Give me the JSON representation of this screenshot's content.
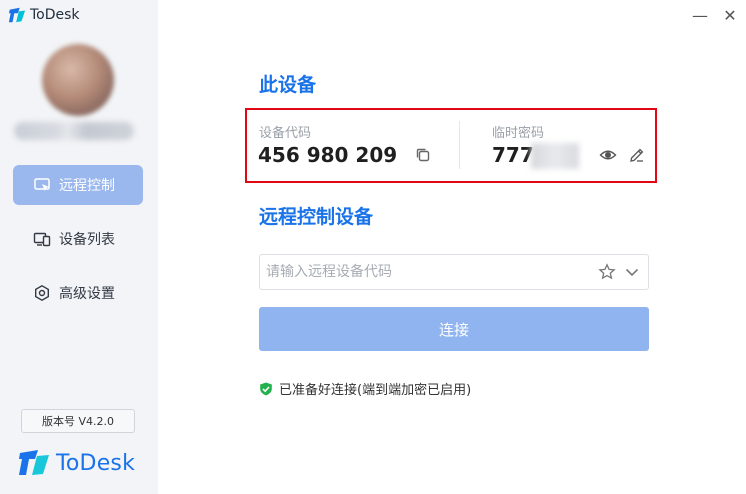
{
  "app": {
    "title": "ToDesk",
    "version_badge": "版本号 V4.2.0",
    "brand_text": "ToDesk",
    "brand_color": "#1a73e8"
  },
  "window_controls": {
    "minimize_label": "—",
    "close_label": "✕"
  },
  "sidebar": {
    "items": [
      {
        "label": "远程控制",
        "icon": "monitor-cursor-icon",
        "active": true
      },
      {
        "label": "设备列表",
        "icon": "devices-icon",
        "active": false
      },
      {
        "label": "高级设置",
        "icon": "hexagon-settings-icon",
        "active": false
      }
    ]
  },
  "this_device": {
    "title": "此设备",
    "device_code_label": "设备代码",
    "device_code": "456 980 209",
    "temp_password_label": "临时密码",
    "temp_password_visible": "777"
  },
  "remote": {
    "title": "远程控制设备",
    "input_placeholder": "请输入远程设备代码",
    "input_value": "",
    "connect_label": "连接"
  },
  "status": {
    "text": "已准备好连接(端到端加密已启用)",
    "color": "#22b14c"
  },
  "colors": {
    "accent": "#1a73e8",
    "highlight_border": "#e30613",
    "connect_button": "#8fb4ef",
    "active_nav": "#9bb8ee"
  }
}
